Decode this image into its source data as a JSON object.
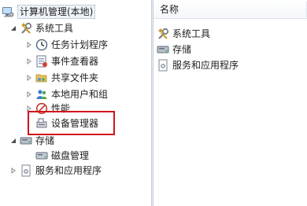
{
  "tree": {
    "root": "计算机管理(本地)",
    "system_tools": "系统工具",
    "task_scheduler": "任务计划程序",
    "event_viewer": "事件查看器",
    "shared_folders": "共享文件夹",
    "local_users_groups": "本地用户和组",
    "performance": "性能",
    "device_manager": "设备管理器",
    "storage": "存储",
    "disk_management": "磁盘管理",
    "services_apps": "服务和应用程序"
  },
  "list": {
    "column_name": "名称",
    "items": [
      "系统工具",
      "存储",
      "服务和应用程序"
    ]
  },
  "colors": {
    "highlight": "#d0141b",
    "selection_bg": "#eef3fa"
  }
}
